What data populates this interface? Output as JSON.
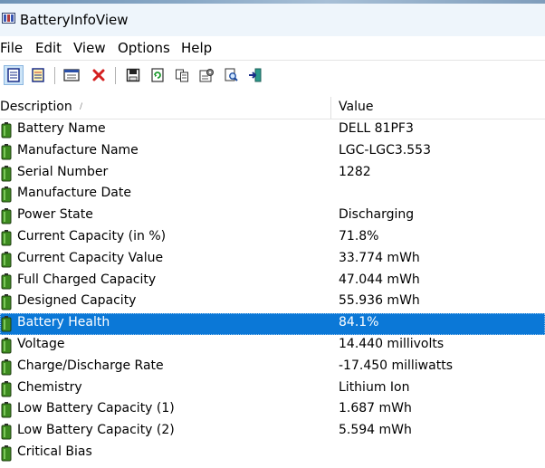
{
  "window": {
    "title": "BatteryInfoView"
  },
  "menu": [
    "File",
    "Edit",
    "View",
    "Options",
    "Help"
  ],
  "toolbar": {
    "buttons": [
      "html-report-icon",
      "properties-list-icon",
      "options-window-icon",
      "delete-icon",
      "save-icon",
      "refresh-icon",
      "copy-icon",
      "properties-icon",
      "find-icon",
      "exit-icon"
    ]
  },
  "columns": {
    "description": "Description",
    "value": "Value"
  },
  "rows": [
    {
      "description": "Battery Name",
      "value": "DELL 81PF3"
    },
    {
      "description": "Manufacture Name",
      "value": "LGC-LGC3.553"
    },
    {
      "description": "Serial Number",
      "value": "1282"
    },
    {
      "description": "Manufacture Date",
      "value": ""
    },
    {
      "description": "Power State",
      "value": "Discharging"
    },
    {
      "description": "Current Capacity (in %)",
      "value": "71.8%"
    },
    {
      "description": "Current Capacity Value",
      "value": "33.774 mWh"
    },
    {
      "description": "Full Charged Capacity",
      "value": "47.044 mWh"
    },
    {
      "description": "Designed Capacity",
      "value": "55.936 mWh"
    },
    {
      "description": "Battery Health",
      "value": "84.1%",
      "selected": true
    },
    {
      "description": "Voltage",
      "value": "14.440 millivolts"
    },
    {
      "description": "Charge/Discharge Rate",
      "value": "-17.450 milliwatts"
    },
    {
      "description": "Chemistry",
      "value": "Lithium Ion"
    },
    {
      "description": "Low Battery Capacity (1)",
      "value": "1.687 mWh"
    },
    {
      "description": "Low Battery Capacity (2)",
      "value": "5.594 mWh"
    },
    {
      "description": "Critical Bias",
      "value": ""
    }
  ],
  "colors": {
    "selection": "#0b78d7",
    "battery_green": "#3c8a1f"
  }
}
